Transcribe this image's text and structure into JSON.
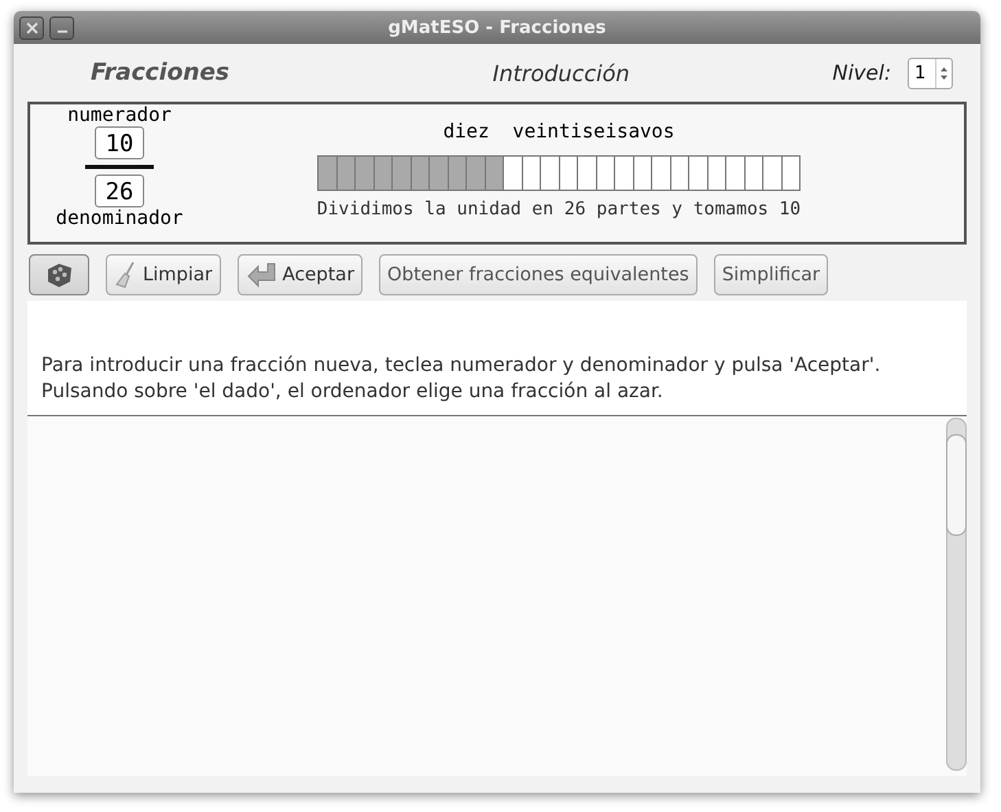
{
  "window": {
    "title": "gMatESO - Fracciones"
  },
  "header": {
    "app_title": "Fracciones",
    "section": "Introducción",
    "level_label": "Nivel:",
    "level_value": "1"
  },
  "fraction": {
    "numerator_label": "numerador",
    "numerator": "10",
    "denominator": "26",
    "denominator_label": "denominador",
    "name": "diez  veintiseisavos",
    "caption": "Dividimos la unidad en 26 partes y tomamos 10",
    "cells": [
      {
        "filled": true
      },
      {
        "filled": true
      },
      {
        "filled": true
      },
      {
        "filled": true
      },
      {
        "filled": true
      },
      {
        "filled": true
      },
      {
        "filled": true
      },
      {
        "filled": true
      },
      {
        "filled": true
      },
      {
        "filled": true
      },
      {
        "filled": false
      },
      {
        "filled": false
      },
      {
        "filled": false
      },
      {
        "filled": false
      },
      {
        "filled": false
      },
      {
        "filled": false
      },
      {
        "filled": false
      },
      {
        "filled": false
      },
      {
        "filled": false
      },
      {
        "filled": false
      },
      {
        "filled": false
      },
      {
        "filled": false
      },
      {
        "filled": false
      },
      {
        "filled": false
      },
      {
        "filled": false
      },
      {
        "filled": false
      }
    ]
  },
  "toolbar": [
    {
      "kind": "dice"
    },
    {
      "kind": "broom",
      "label": "Limpiar"
    },
    {
      "kind": "enter",
      "label": "Aceptar"
    },
    {
      "kind": "text",
      "label": "Obtener fracciones equivalentes"
    },
    {
      "kind": "text",
      "label": "Simplificar"
    }
  ],
  "instructions": [
    "Para introducir una fracción nueva, teclea numerador y denominador y pulsa 'Aceptar'.",
    "Pulsando sobre 'el dado', el ordenador elige una fracción al azar."
  ]
}
